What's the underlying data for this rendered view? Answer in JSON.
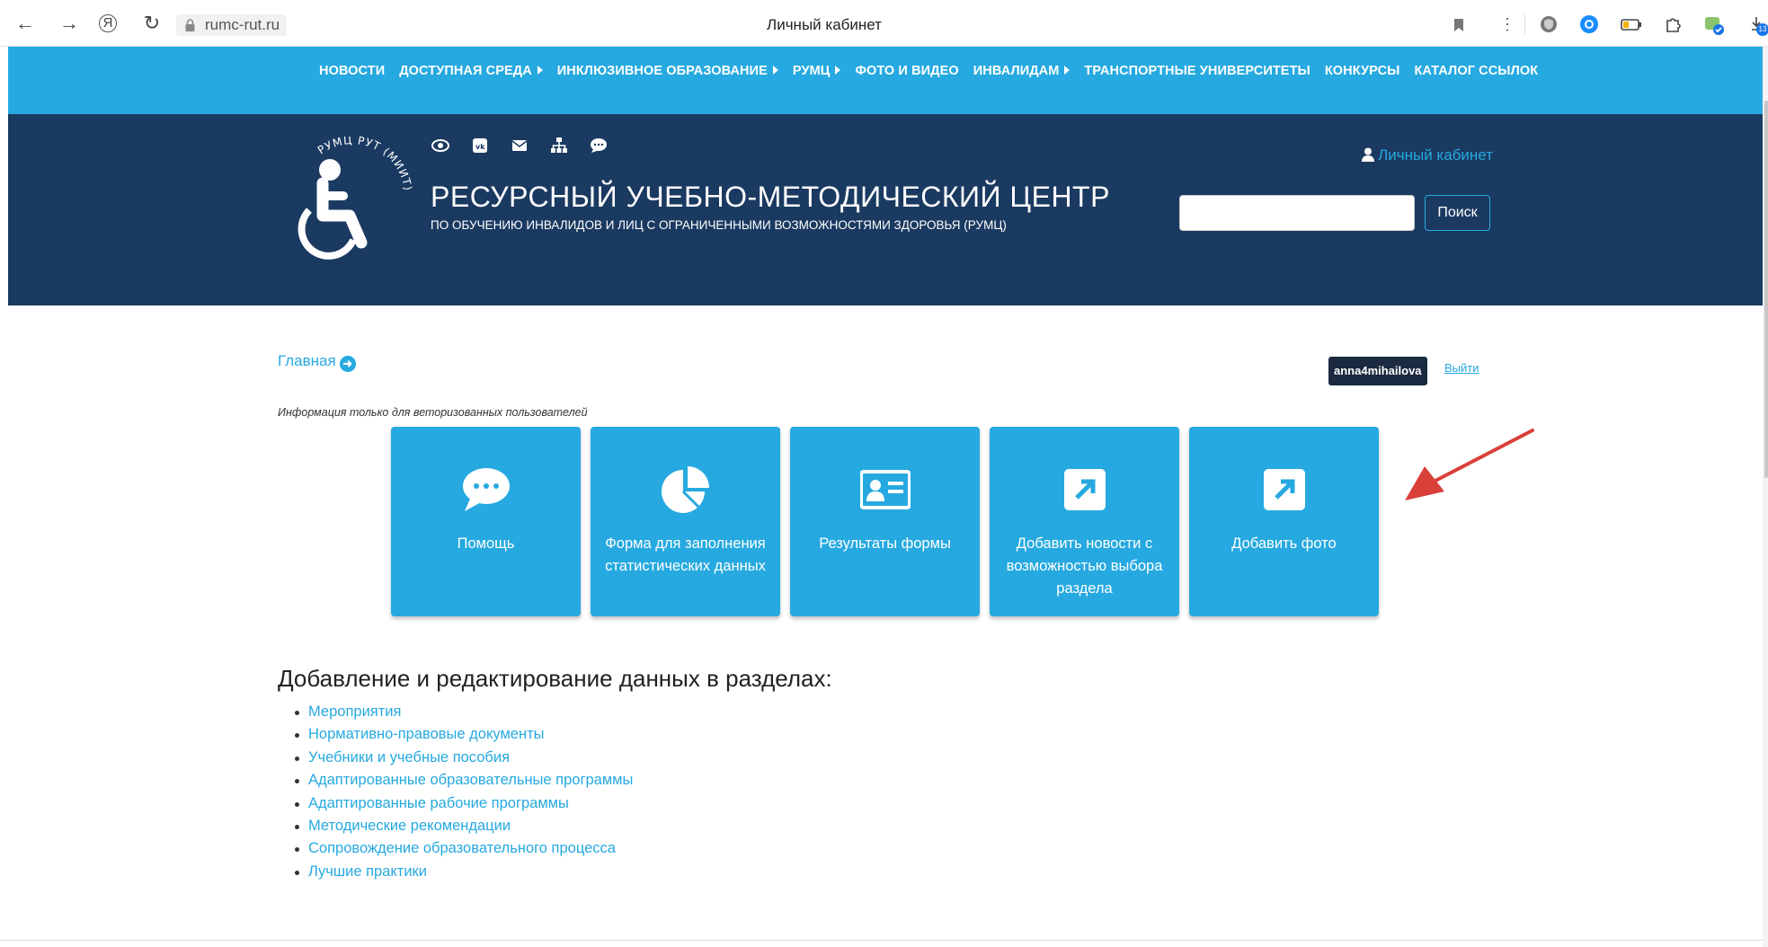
{
  "browser": {
    "url": "rumc-rut.ru",
    "tab_title": "Личный кабинет",
    "extension_badge": "13"
  },
  "topnav": {
    "items": [
      {
        "label": "НОВОСТИ",
        "caret": false
      },
      {
        "label": "ДОСТУПНАЯ СРЕДА",
        "caret": true
      },
      {
        "label": "ИНКЛЮЗИВНОЕ ОБРАЗОВАНИЕ",
        "caret": true
      },
      {
        "label": "РУМЦ",
        "caret": true
      },
      {
        "label": "ФОТО И ВИДЕО",
        "caret": false
      },
      {
        "label": "ИНВАЛИДАМ",
        "caret": true
      },
      {
        "label": "ТРАНСПОРТНЫЕ УНИВЕРСИТЕТЫ",
        "caret": false
      },
      {
        "label": "КОНКУРСЫ",
        "caret": false
      },
      {
        "label": "КАТАЛОГ ССЫЛОК",
        "caret": false
      }
    ]
  },
  "header": {
    "logo_text": "РУМЦ РУТ (МИИТ)",
    "title": "РЕСУРСНЫЙ УЧЕБНО-МЕТОДИЧЕСКИЙ ЦЕНТР",
    "subtitle": "ПО ОБУЧЕНИЮ ИНВАЛИДОВ И ЛИЦ С ОГРАНИЧЕННЫМИ ВОЗМОЖНОСТЯМИ ЗДОРОВЬЯ (РУМЦ)",
    "account_link": "Личный кабинет",
    "search_value": "",
    "search_button": "Поиск",
    "social_icons": [
      "eye-icon",
      "vk-icon",
      "mail-icon",
      "sitemap-icon",
      "chat-icon"
    ]
  },
  "main": {
    "breadcrumb": "Главная",
    "username": "anna4mihailova",
    "logout": "Выйти",
    "auth_note": "Информация только для веторизованных пользователей",
    "tiles": [
      {
        "label": "Помощь",
        "icon": "chat-bubble-icon"
      },
      {
        "label": "Форма для заполнения статистических данных",
        "icon": "pie-chart-icon"
      },
      {
        "label": "Результаты формы",
        "icon": "id-card-icon"
      },
      {
        "label": "Добавить новости с возможностью выбора раздела",
        "icon": "external-link-icon"
      },
      {
        "label": "Добавить фото",
        "icon": "external-link-icon"
      }
    ],
    "section_title": "Добавление и редактирование данных в разделах:",
    "sections": [
      "Мероприятия",
      "Нормативно-правовые документы",
      "Учебники и учебные пособия",
      "Адаптированные образовательные программы",
      "Адаптированные рабочие программы",
      "Методические рекомендации",
      "Сопровождение образовательного процесса",
      "Лучшие практики"
    ]
  },
  "colors": {
    "nav_blue": "#26a9e0",
    "header_navy": "#1b3a61",
    "annotation_arrow": "#d9403a"
  }
}
